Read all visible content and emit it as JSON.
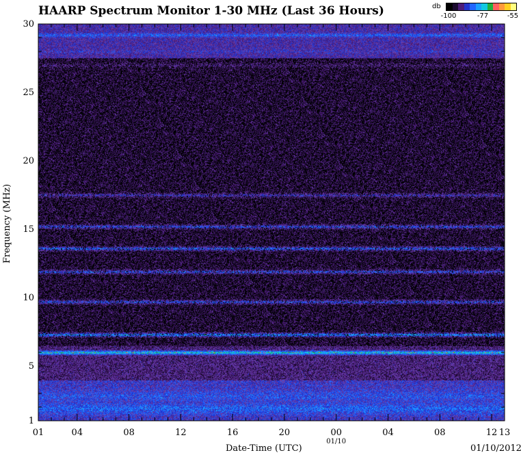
{
  "header": {
    "title": "HAARP Spectrum Monitor 1-30 MHz (Last 36 Hours)",
    "date_stamp": "01/10/2012"
  },
  "colorbar": {
    "unit": "db",
    "ticks": [
      "-100",
      "-77",
      "-55"
    ],
    "tick_values": [
      -100,
      -77,
      -55
    ],
    "colors": [
      "#000000",
      "#1a0a2e",
      "#4b1c78",
      "#2233cc",
      "#2266ff",
      "#1aa0ff",
      "#12c8e0",
      "#20b040",
      "#ff6060",
      "#ff9a3c",
      "#ffd020",
      "#ffff80"
    ]
  },
  "chart_data": {
    "type": "heatmap",
    "title": "HAARP Spectrum Monitor 1-30 MHz (Last 36 Hours)",
    "xlabel": "Date-Time (UTC)",
    "ylabel": "Frequency (MHz)",
    "ylim": [
      1,
      30
    ],
    "y_ticks": [
      1,
      5,
      10,
      15,
      20,
      25,
      30
    ],
    "x_tick_labels": [
      "01",
      "04",
      "08",
      "12",
      "16",
      "20",
      "00",
      "04",
      "08",
      "12",
      "13"
    ],
    "x_tick_hours": [
      0,
      3,
      7,
      11,
      15,
      19,
      23,
      27,
      31,
      35,
      36
    ],
    "x_sublabel": "01/10",
    "x_range_hours": [
      0,
      36
    ],
    "colorbar_range_db": [
      -100,
      -55
    ],
    "bands": [
      {
        "freq_mhz": 29.2,
        "level_db": -80
      },
      {
        "freq_mhz": 28.0,
        "level_db": -86
      },
      {
        "freq_mhz": 27.0,
        "level_db": -90
      },
      {
        "freq_mhz": 17.5,
        "level_db": -84
      },
      {
        "freq_mhz": 15.2,
        "level_db": -80
      },
      {
        "freq_mhz": 13.6,
        "level_db": -78
      },
      {
        "freq_mhz": 11.9,
        "level_db": -80
      },
      {
        "freq_mhz": 9.7,
        "level_db": -80
      },
      {
        "freq_mhz": 7.3,
        "level_db": -74
      },
      {
        "freq_mhz": 6.0,
        "level_db": -68
      },
      {
        "freq_mhz": 2.8,
        "level_db": -82
      },
      {
        "freq_mhz": 1.9,
        "level_db": -80
      }
    ]
  }
}
